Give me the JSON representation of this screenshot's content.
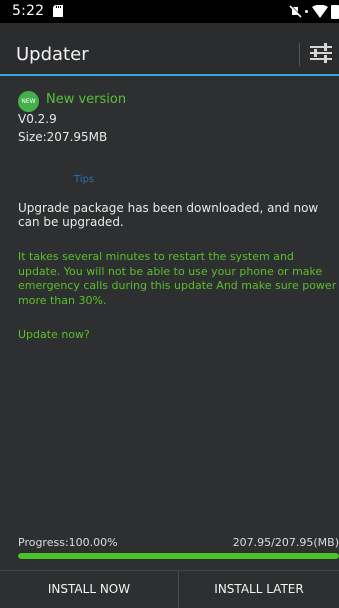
{
  "status_bar": {
    "time": "5:22",
    "icons": [
      "sd-card-icon",
      "mute-icon",
      "data-dot-icon",
      "wifi-icon",
      "battery-icon"
    ]
  },
  "app_bar": {
    "title": "Updater",
    "action_icon": "settings-sliders-icon",
    "accent_color": "#35a7d8"
  },
  "update_info": {
    "badge": "NEW",
    "status": "New version",
    "version": "V0.2.9",
    "size": "Size:207.95MB"
  },
  "message": {
    "tips_title": "Tips",
    "downloaded": "Upgrade package has been downloaded, and now can be upgraded.",
    "warning": "It takes several minutes to restart the system and update. You will not be able to use your phone or make emergency calls during this update And make sure power more than 30%.",
    "question": "Update now?"
  },
  "progress": {
    "label": "Progress:100.00%",
    "value": 1.0,
    "size_text": "207.95/207.95(MB)",
    "color": "#4bc32b"
  },
  "buttons": {
    "install_now": "INSTALL NOW",
    "install_later": "INSTALL LATER"
  },
  "colors": {
    "green_text": "#5cbf2a",
    "tips_blue": "#2f6fb0",
    "background": "#2d2f30"
  }
}
